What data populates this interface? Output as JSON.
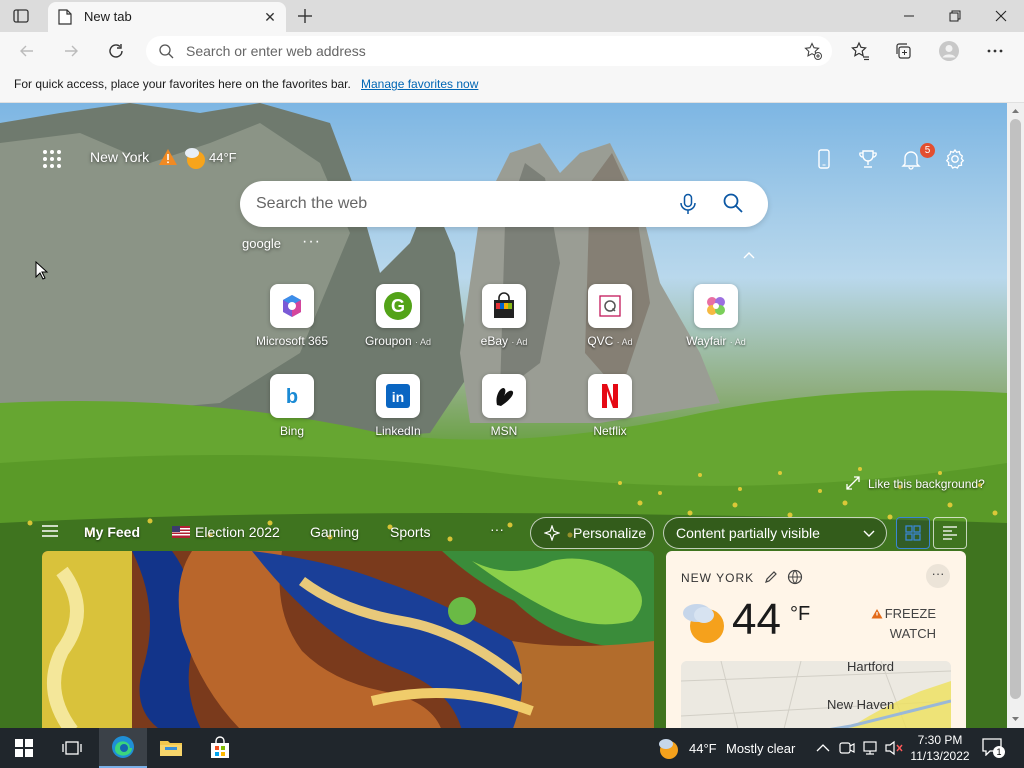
{
  "browser": {
    "tab_title": "New tab",
    "address_placeholder": "Search or enter web address",
    "favorites_bar_message": "For quick access, place your favorites here on the favorites bar.",
    "favorites_bar_link": "Manage favorites now"
  },
  "newtab": {
    "location": "New York",
    "temperature": "44°F",
    "notification_count": "5",
    "search_placeholder": "Search the web",
    "suggestion": "google",
    "like_background": "Like this background?",
    "tiles": [
      {
        "label": "Microsoft 365",
        "ad": "",
        "icon": "microsoft-365-icon"
      },
      {
        "label": "Groupon",
        "ad": "· Ad",
        "icon": "groupon-icon"
      },
      {
        "label": "eBay",
        "ad": "· Ad",
        "icon": "ebay-icon"
      },
      {
        "label": "QVC",
        "ad": "· Ad",
        "icon": "qvc-icon"
      },
      {
        "label": "Wayfair",
        "ad": "· Ad",
        "icon": "wayfair-icon"
      },
      {
        "label": "Bing",
        "ad": "",
        "icon": "bing-icon"
      },
      {
        "label": "LinkedIn",
        "ad": "",
        "icon": "linkedin-icon"
      },
      {
        "label": "MSN",
        "ad": "",
        "icon": "msn-icon"
      },
      {
        "label": "Netflix",
        "ad": "",
        "icon": "netflix-icon"
      }
    ]
  },
  "feed": {
    "nav": [
      "My Feed",
      "Election 2022",
      "Gaming",
      "Sports"
    ],
    "more": "···",
    "personalize": "Personalize",
    "content_visibility": "Content partially visible"
  },
  "weather_card": {
    "title": "NEW YORK",
    "temp": "44",
    "unit": "°F",
    "alert_line1": "FREEZE",
    "alert_line2": "WATCH",
    "more": "···",
    "map_label_1": "Hartford",
    "map_label_2": "New Haven"
  },
  "taskbar": {
    "weather_temp": "44°F",
    "weather_text": "Mostly clear",
    "time": "7:30 PM",
    "date": "11/13/2022",
    "notifications": "1"
  },
  "colors": {
    "accent_link": "#0066b4",
    "badge": "#e34e2f",
    "taskbar": "#20262c"
  }
}
